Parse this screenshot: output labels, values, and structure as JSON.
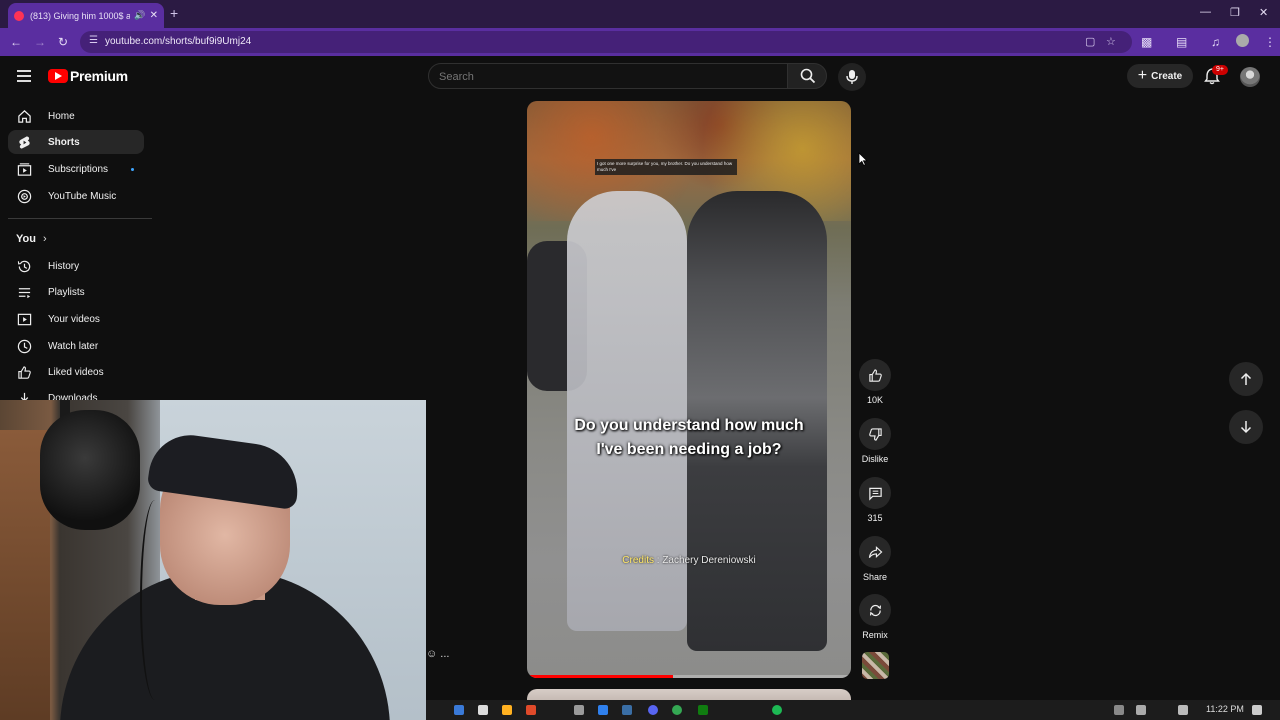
{
  "browser": {
    "tab_title": "(813) Giving him 1000$ an...",
    "new_tab": "+",
    "url": "youtube.com/shorts/buf9i9Umj24"
  },
  "masthead": {
    "brand": "Premium",
    "search_placeholder": "Search",
    "create_label": "Create",
    "notification_badge": "9+"
  },
  "sidebar": {
    "items": [
      {
        "label": "Home"
      },
      {
        "label": "Shorts"
      },
      {
        "label": "Subscriptions"
      },
      {
        "label": "YouTube Music"
      }
    ],
    "you_header": "You",
    "you_items": [
      {
        "label": "History"
      },
      {
        "label": "Playlists"
      },
      {
        "label": "Your videos"
      },
      {
        "label": "Watch later"
      },
      {
        "label": "Liked videos"
      },
      {
        "label": "Downloads"
      }
    ]
  },
  "video": {
    "small_caption": "I got one more surprise for you, my brother. Do you understand how much I've",
    "caption_line1": "Do you understand how much",
    "caption_line2": "I've been needing a job?",
    "credits_label": "Credits",
    "credits_sep": " : ",
    "credits_name": "Zachery Dereniowski",
    "progress": 0.45
  },
  "actions": {
    "like_count": "10K",
    "dislike_label": "Dislike",
    "comment_count": "315",
    "share_label": "Share",
    "remix_label": "Remix"
  },
  "taskbar": {
    "time": "11:22 PM",
    "tray_more": "..."
  },
  "colors": {
    "brand_red": "#ff0000",
    "chrome_purple": "#5a2ea0",
    "background": "#0f0f0f",
    "credits_yellow": "#ffe766"
  }
}
